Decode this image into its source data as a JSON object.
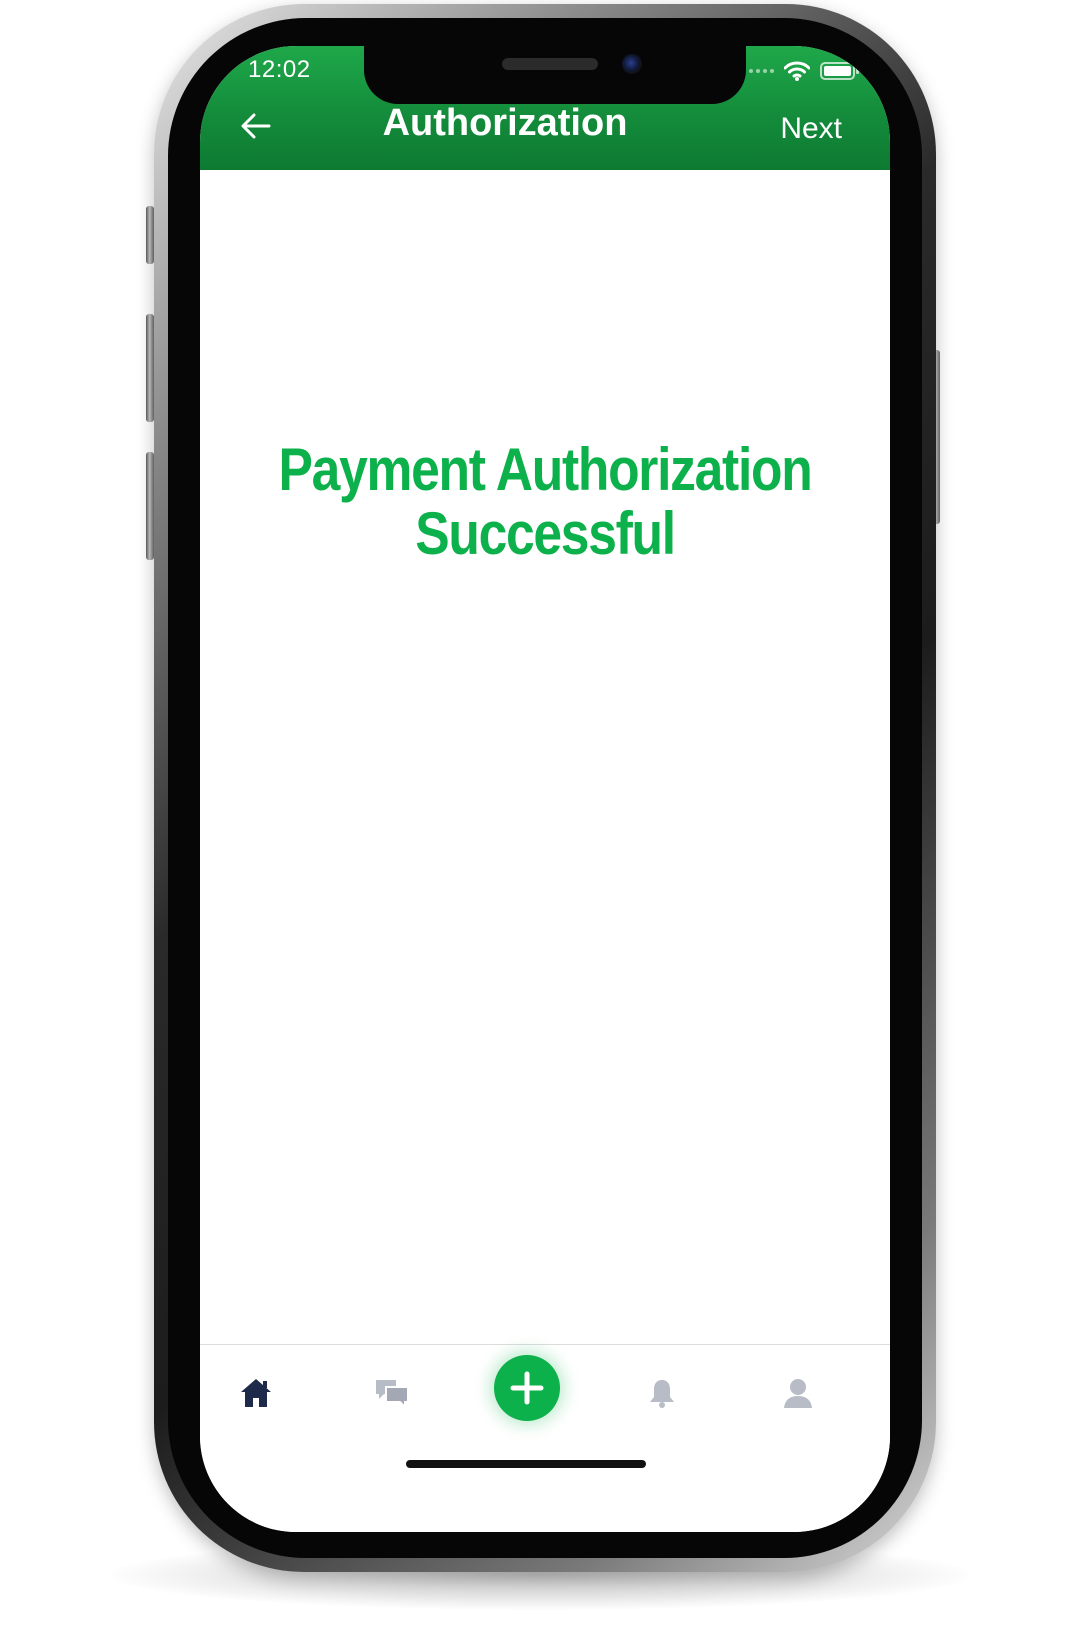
{
  "status_bar": {
    "time": "12:02"
  },
  "header": {
    "title": "Authorization",
    "next_label": "Next",
    "back_icon": "arrow-left-icon"
  },
  "main": {
    "message_line1": "Payment Authorization",
    "message_line2": "Successful"
  },
  "tab_bar": {
    "items": [
      {
        "icon": "home-icon",
        "active": true
      },
      {
        "icon": "chat-icon",
        "active": false
      },
      {
        "icon": "plus-icon",
        "active": false
      },
      {
        "icon": "bell-icon",
        "active": false
      },
      {
        "icon": "profile-icon",
        "active": false
      }
    ]
  },
  "colors": {
    "brand_green": "#0db14b",
    "header_green": "#148c3b",
    "active_tab": "#1e2a4a",
    "inactive_tab": "#b8bcc6"
  }
}
